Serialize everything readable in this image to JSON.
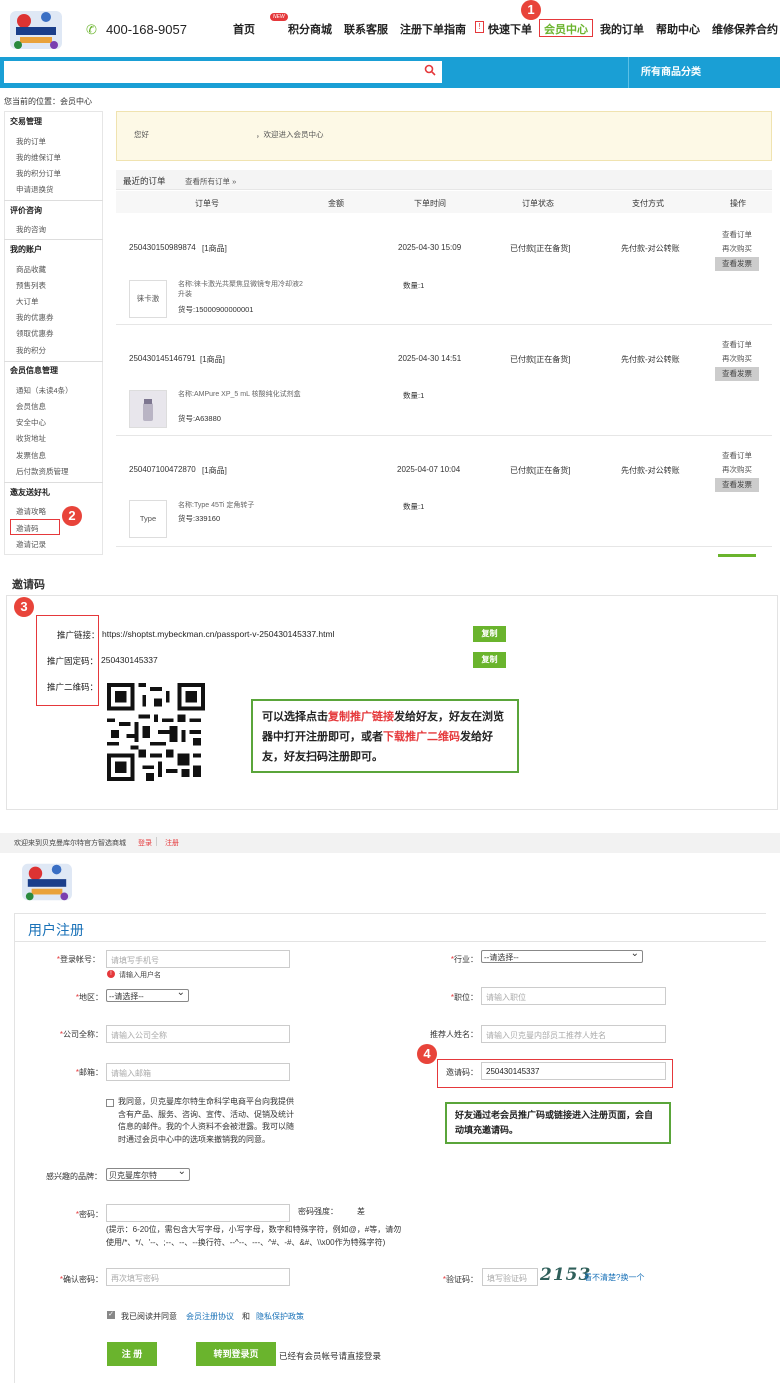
{
  "header": {
    "logo_text": "BECKMAN COULTER Life Sciences",
    "phone": "400-168-9057",
    "nav": [
      "首页",
      "积分商城",
      "联系客服",
      "注册下单指南",
      "快速下单",
      "会员中心",
      "我的订单",
      "帮助中心",
      "维修保养合约"
    ],
    "new_badge": "NEW",
    "categories": "所有商品分类"
  },
  "breadcrumb": "您当前的位置：会员中心",
  "sidebar": {
    "groups": [
      {
        "title": "交易管理",
        "items": [
          "我的订单",
          "我的维保订单",
          "我的积分订单",
          "申请退换货"
        ]
      },
      {
        "title": "评价咨询",
        "items": [
          "我的咨询"
        ]
      },
      {
        "title": "我的账户",
        "items": [
          "商品收藏",
          "预售列表",
          "大订单",
          "我的优惠券",
          "领取优惠券",
          "我的积分"
        ]
      },
      {
        "title": "会员信息管理",
        "items": [
          "通知（未读4条）",
          "会员信息",
          "安全中心",
          "收货地址",
          "发票信息",
          "后付款资质管理"
        ]
      },
      {
        "title": "邀友送好礼",
        "items": [
          "邀请攻略",
          "邀请码",
          "邀请记录"
        ]
      }
    ]
  },
  "welcome": {
    "prefix": "您好",
    "suffix": "，欢迎进入会员中心"
  },
  "orders": {
    "tab": "最近的订单",
    "view_all": "查看所有订单 »",
    "columns": [
      "订单号",
      "金额",
      "下单时间",
      "订单状态",
      "支付方式",
      "操作"
    ],
    "rows": [
      {
        "id": "250430150989874",
        "count": "[1商品]",
        "time": "2025-04-30 15:09",
        "status": "已付款[正在备货]",
        "pay": "先付款-对公转账",
        "thumb": "徕卡激",
        "name": "名称:徕卡激光共聚焦显微镜专用冷却液2升装",
        "sku": "货号:15000900000001",
        "qty": "数量:1"
      },
      {
        "id": "250430145146791",
        "count": "[1商品]",
        "time": "2025-04-30 14:51",
        "status": "已付款[正在备货]",
        "pay": "先付款-对公转账",
        "thumb": "",
        "name": "名称:AMPure XP_5 mL 核酸纯化试剂盒",
        "sku": "货号:A63880",
        "qty": "数量:1"
      },
      {
        "id": "250407100472870",
        "count": "[1商品]",
        "time": "2025-04-07 10:04",
        "status": "已付款[正在备货]",
        "pay": "先付款-对公转账",
        "thumb": "Type",
        "name": "名称:Type 45Ti 定角转子",
        "sku": "货号:339160",
        "qty": "数量:1"
      }
    ],
    "ops": [
      "查看订单",
      "再次购买",
      "查看发票"
    ]
  },
  "invite": {
    "title": "邀请码",
    "link_label": "推广链接：",
    "link": "https://shoptst.mybeckman.cn/passport-v-250430145337.html",
    "code_label": "推广固定码：",
    "code": "250430145337",
    "qr_label": "推广二维码：",
    "copy": "复制",
    "note_1": "可以选择点击",
    "note_red1": "复制推广链接",
    "note_2": "发给好友，好友在浏览器中打开注册即可，或者",
    "note_red2": "下载推广二维码",
    "note_3": "发给好友，好友扫码注册即可。"
  },
  "register": {
    "topbar": "欢迎来到贝克曼库尔特官方智选商城",
    "login": "登录",
    "signup": "注册",
    "title": "用户注册",
    "account_label": "登录帐号：",
    "account_ph": "请填写手机号",
    "account_err": "请输入用户名",
    "industry_label": "行业：",
    "industry_val": "--请选择--",
    "region_label": "地区：",
    "region_val": "--请选择--",
    "position_label": "职位：",
    "position_ph": "请输入职位",
    "company_label": "公司全称：",
    "company_ph": "请输入公司全称",
    "referrer_label": "推荐人姓名：",
    "referrer_ph": "请输入贝克曼内部员工推荐人姓名",
    "email_label": "邮箱：",
    "email_ph": "请输入邮箱",
    "invite_label": "邀请码：",
    "invite_val": "250430145337",
    "consent": "我同意，贝克曼库尔特生命科学电商平台向我提供含有产品、服务、咨询、宣传、活动、促销及统计信息的邮件。我的个人资料不会被泄露。我可以随时通过会员中心中的选项来撤销我的同意。",
    "note4": "好友通过老会员推广码或链接进入注册页面，会自动填充邀请码。",
    "brand_label": "感兴趣的品牌：",
    "brand_val": "贝克曼库尔特",
    "pwd_label": "密码：",
    "strength_label": "密码强度：",
    "strength_val": "差",
    "pwd_hint": "(提示：6-20位，需包含大写字母，小写字母，数字和特殊字符，例如@，#等，请勿使用/*、*/、'--、;--、--、--换行符、--^--、---、^#、-#、&#、\\\\x00作为特殊字符)",
    "confirm_label": "确认密码：",
    "confirm_ph": "再次填写密码",
    "captcha_label": "验证码：",
    "captcha_ph": "填写验证码",
    "captcha_img": "2153",
    "captcha_refresh": "看不清楚?换一个",
    "agree_prefix": "我已阅读并同意",
    "agree_link1": "会员注册协议",
    "agree_and": "和",
    "agree_link2": "隐私保护政策",
    "submit": "注  册",
    "to_login": "转到登录页",
    "to_login_note": "已经有会员帐号请直接登录"
  },
  "steps": [
    "1",
    "2",
    "3",
    "4"
  ],
  "colors": {
    "accent_blue": "#1a9fd5",
    "green": "#6ab42d",
    "red": "#e5383b",
    "note_green": "#5aa53a"
  }
}
